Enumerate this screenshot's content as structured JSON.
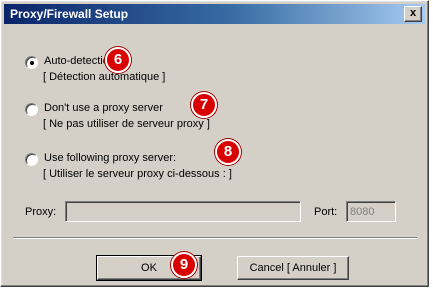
{
  "window": {
    "title": "Proxy/Firewall Setup",
    "close_label": "x"
  },
  "options": [
    {
      "label": "Auto-detection",
      "sublabel": "[ Détection automatique ]",
      "selected": true,
      "badge": "6"
    },
    {
      "label": "Don't use a proxy server",
      "sublabel": "[ Ne pas utiliser de serveur proxy ]",
      "selected": false,
      "badge": "7"
    },
    {
      "label": "Use following proxy server:",
      "sublabel": "[ Utiliser le serveur proxy ci-dessous : ]",
      "selected": false,
      "badge": "8"
    }
  ],
  "proxy": {
    "label": "Proxy:",
    "value": "",
    "port_label": "Port:",
    "port_value": "8080"
  },
  "buttons": {
    "ok_label": "OK",
    "ok_badge": "9",
    "cancel_label": "Cancel [ Annuler ]"
  }
}
